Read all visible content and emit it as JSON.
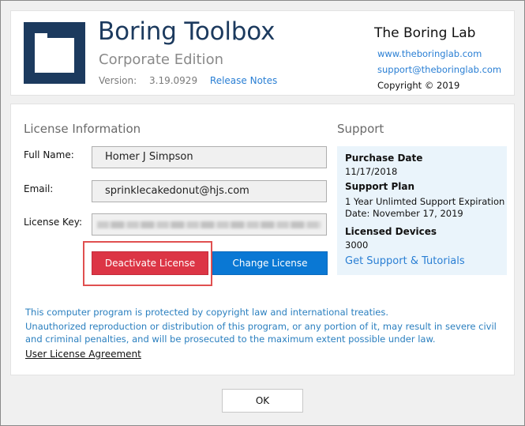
{
  "header": {
    "app_title": "Boring Toolbox",
    "edition": "Corporate Edition",
    "version_label": "Version:",
    "version_value": "3.19.0929",
    "release_notes_link": "Release Notes",
    "company_name": "The Boring Lab",
    "website": "www.theboringlab.com",
    "email": "support@theboringlab.com",
    "copyright": "Copyright © 2019",
    "logo_icon": "square-bracket-logo-icon",
    "logo_color": "#1c3a5e"
  },
  "license": {
    "title": "License Information",
    "full_name_label": "Full Name:",
    "full_name_value": "Homer J Simpson",
    "email_label": "Email:",
    "email_value": "sprinklecakedonut@hjs.com",
    "key_label": "License Key:",
    "deactivate_label": "Deactivate License",
    "change_label": "Change License",
    "deactivate_color": "#dc3545",
    "change_color": "#0a78d4"
  },
  "support": {
    "title": "Support",
    "purchase_date_heading": "Purchase Date",
    "purchase_date_value": "11/17/2018",
    "plan_heading": "Support Plan",
    "plan_value_line1": "1 Year Unlimted Support Expiration",
    "plan_value_line2": "Date: November 17, 2019",
    "devices_heading": "Licensed Devices",
    "devices_value": "3000",
    "tutorials_link": "Get Support & Tutorials"
  },
  "legal": {
    "line1": "This computer program is protected by copyright law and international treaties.",
    "line2": "Unauthorized reproduction or distribution of this program, or any portion of it, may result in severe civil and criminal penalties, and will be prosecuted to the maximum extent possible under law.",
    "agreement_link": "User License Agreement"
  },
  "footer": {
    "ok_label": "OK"
  }
}
